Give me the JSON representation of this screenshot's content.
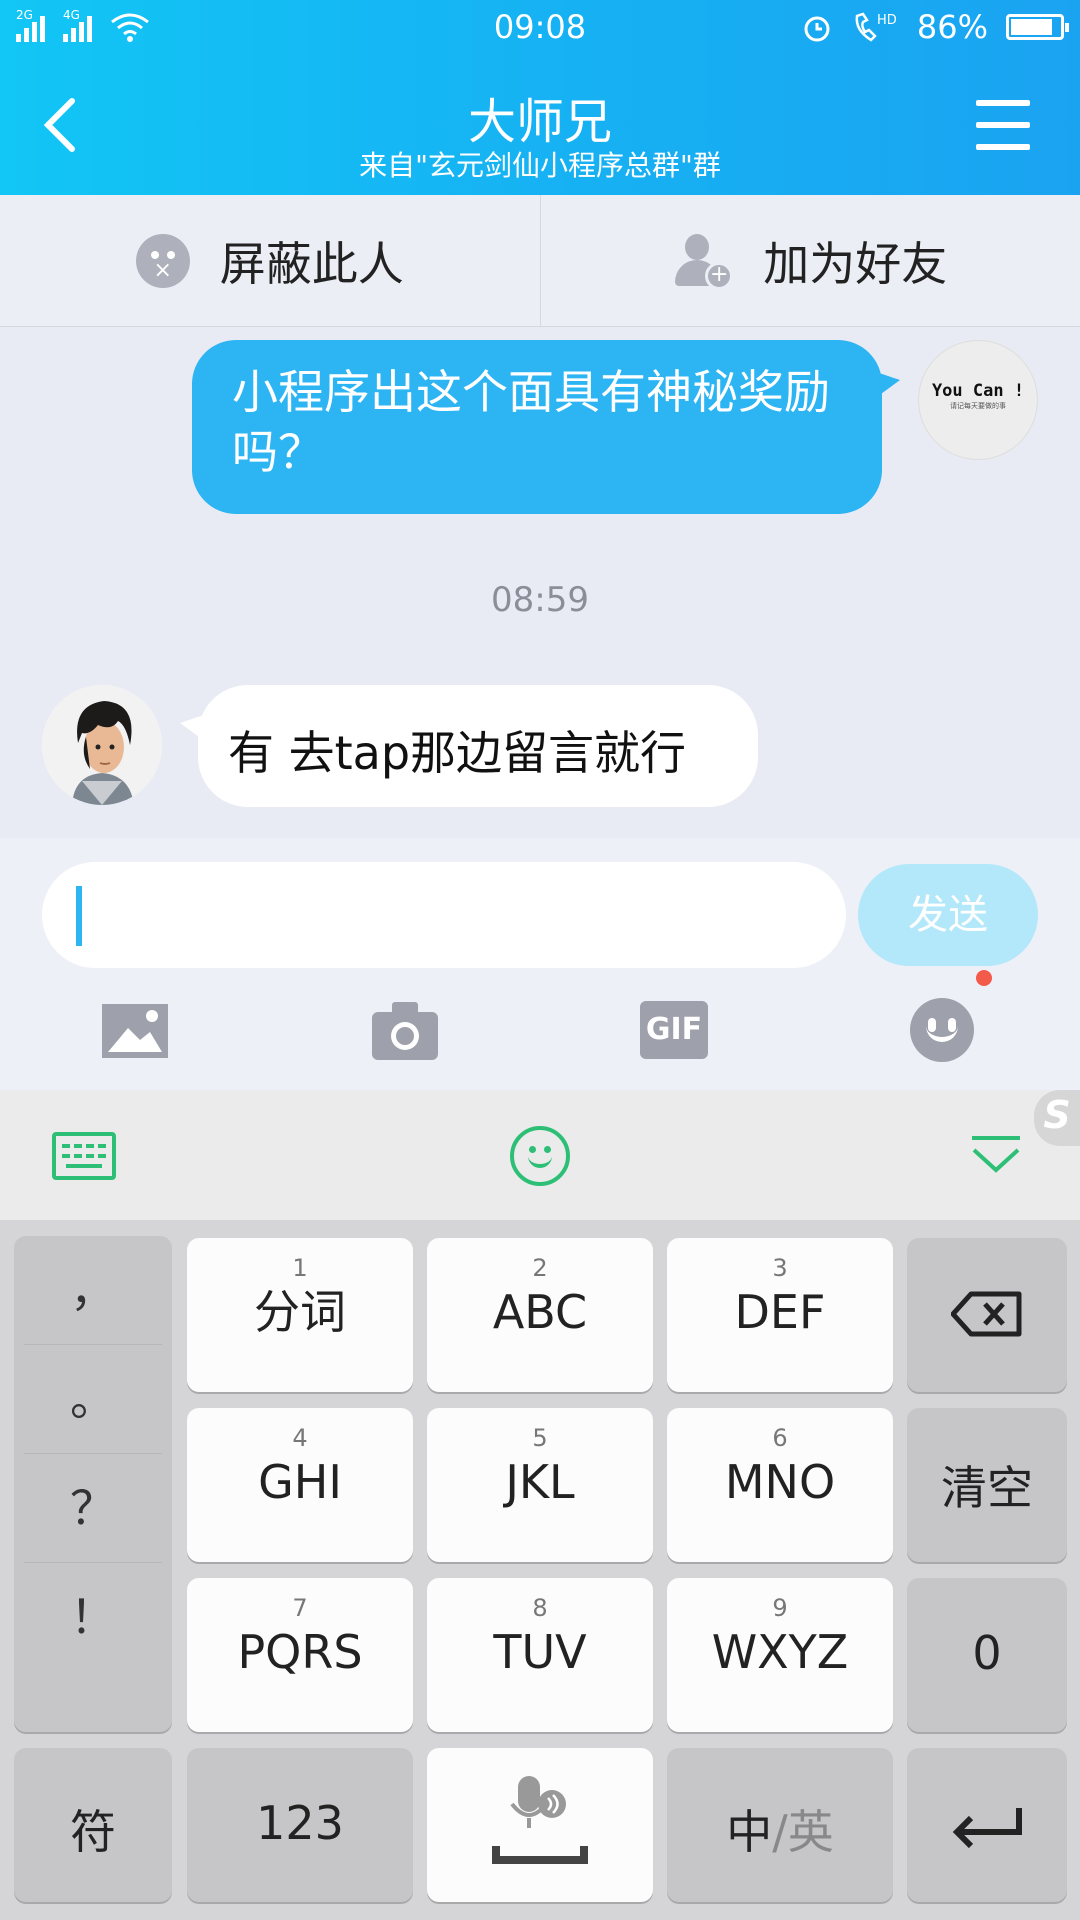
{
  "status": {
    "net1": "2G",
    "net2": "4G",
    "time": "09:08",
    "battery": "86%",
    "battery_level": 0.86
  },
  "header": {
    "title": "大师兄",
    "subtitle": "来自\"玄元剑仙小程序总群\"群"
  },
  "actions": {
    "block_label": "屏蔽此人",
    "add_friend_label": "加为好友"
  },
  "chat": {
    "my_avatar_text": "You Can !",
    "my_avatar_subtext": "请记每天要做的事",
    "outgoing_message": "小程序出这个面具有神秘奖励吗？",
    "timestamp": "08:59",
    "incoming_message": "有 去tap那边留言就行"
  },
  "input": {
    "value": "",
    "send_label": "发送"
  },
  "keyboard": {
    "punct": [
      "，",
      "。",
      "？",
      "！"
    ],
    "keys": [
      {
        "num": "1",
        "label": "分词"
      },
      {
        "num": "2",
        "label": "ABC"
      },
      {
        "num": "3",
        "label": "DEF"
      },
      {
        "num": "4",
        "label": "GHI"
      },
      {
        "num": "5",
        "label": "JKL"
      },
      {
        "num": "6",
        "label": "MNO"
      },
      {
        "num": "7",
        "label": "PQRS"
      },
      {
        "num": "8",
        "label": "TUV"
      },
      {
        "num": "9",
        "label": "WXYZ"
      }
    ],
    "clear_label": "清空",
    "zero_label": "0",
    "symbol_label": "符",
    "num_label": "123",
    "lang_zh": "中",
    "lang_sep": "/",
    "lang_en": "英"
  },
  "colors": {
    "header": "#16b2f3",
    "bubble_out": "#2cb4f3",
    "keyboard_accent": "#2dbf76",
    "badge": "#f45a4a"
  }
}
